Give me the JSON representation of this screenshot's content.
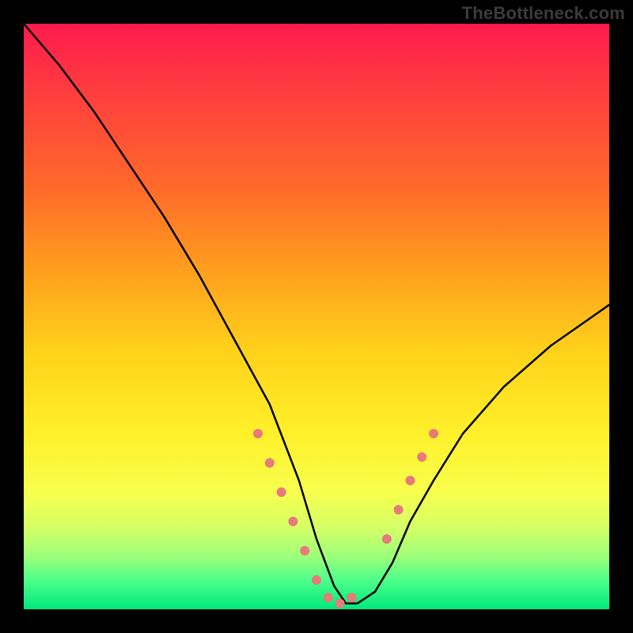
{
  "watermark": "TheBottleneck.com",
  "chart_data": {
    "type": "line",
    "title": "",
    "xlabel": "",
    "ylabel": "",
    "xlim": [
      0,
      100
    ],
    "ylim": [
      0,
      100
    ],
    "grid": false,
    "legend": false,
    "background_gradient": {
      "top": "#ff1a4d",
      "bottom": "#00e87a",
      "note": "vertical rainbow gradient red→orange→yellow→green"
    },
    "series": [
      {
        "name": "bottleneck-curve",
        "color": "#000000",
        "x": [
          0,
          6,
          12,
          18,
          24,
          30,
          36,
          42,
          47,
          50,
          53,
          55,
          57,
          60,
          63,
          66,
          70,
          75,
          82,
          90,
          100
        ],
        "y": [
          100,
          93,
          85,
          76,
          67,
          57,
          46,
          35,
          22,
          12,
          4,
          1,
          1,
          3,
          8,
          15,
          22,
          30,
          38,
          45,
          52
        ]
      },
      {
        "name": "highlight-dots-left",
        "type": "scatter",
        "color": "#e87a7a",
        "x": [
          40,
          42,
          44,
          46,
          48,
          50,
          52,
          54,
          56
        ],
        "y": [
          30,
          25,
          20,
          15,
          10,
          5,
          2,
          1,
          2
        ]
      },
      {
        "name": "highlight-dots-right",
        "type": "scatter",
        "color": "#e87a7a",
        "x": [
          62,
          64,
          66,
          68,
          70
        ],
        "y": [
          12,
          17,
          22,
          26,
          30
        ]
      }
    ]
  }
}
